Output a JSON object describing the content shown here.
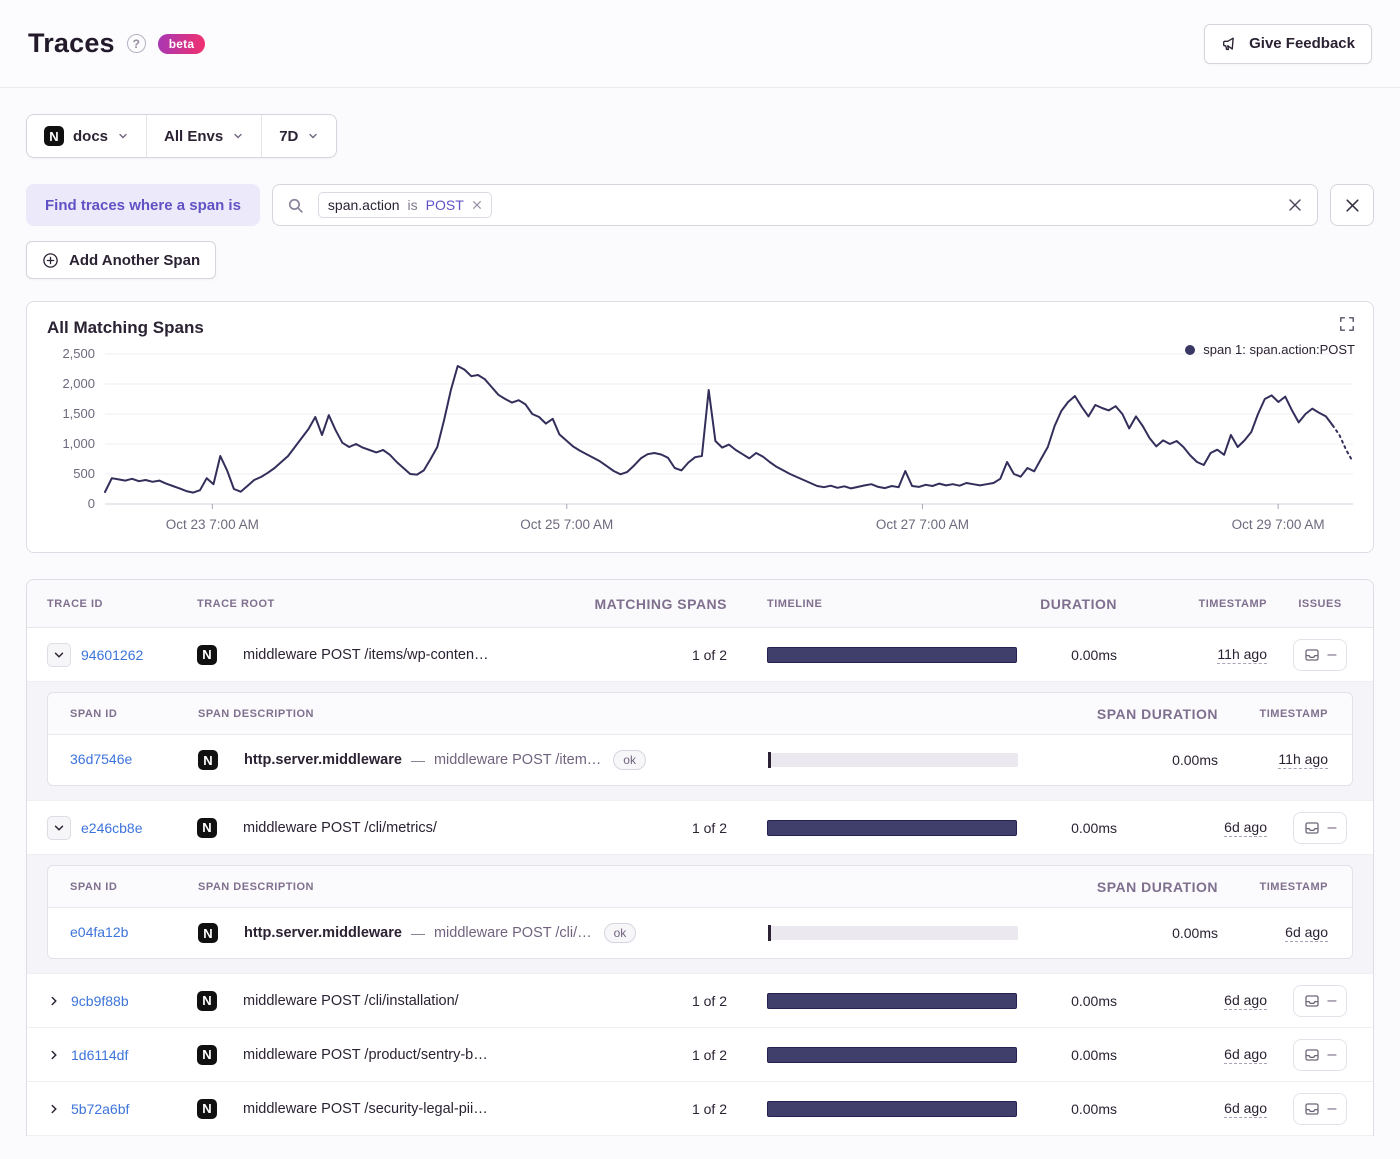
{
  "header": {
    "title": "Traces",
    "help_icon": "?",
    "beta_label": "beta",
    "feedback_label": "Give Feedback"
  },
  "filters": {
    "project": {
      "label": "docs",
      "platform_icon": "N"
    },
    "env": {
      "label": "All Envs"
    },
    "period": {
      "label": "7D"
    }
  },
  "search": {
    "prefix_label": "Find traces where a span is",
    "token": {
      "key": "span.action",
      "op": "is",
      "value": "POST"
    }
  },
  "actions": {
    "add_span_label": "Add Another Span"
  },
  "chart_data": {
    "type": "line",
    "title": "All Matching Spans",
    "legend": "span 1: span.action:POST",
    "series_name": "span 1: span.action:POST",
    "line_color": "#332f5b",
    "ylim": [
      0,
      2500
    ],
    "grid": true,
    "legend_position": "top-right",
    "y_ticks": [
      {
        "v": 0,
        "label": "0"
      },
      {
        "v": 500,
        "label": "500"
      },
      {
        "v": 1000,
        "label": "1,000"
      },
      {
        "v": 1500,
        "label": "1,500"
      },
      {
        "v": 2000,
        "label": "2,000"
      },
      {
        "v": 2500,
        "label": "2,500"
      }
    ],
    "x_ticks": [
      {
        "f": 0.086,
        "label": "Oct 23 7:00 AM"
      },
      {
        "f": 0.37,
        "label": "Oct 25 7:00 AM"
      },
      {
        "f": 0.655,
        "label": "Oct 27 7:00 AM"
      },
      {
        "f": 0.94,
        "label": "Oct 29 7:00 AM"
      }
    ],
    "tail_dotted_points": 3,
    "values": [
      200,
      430,
      410,
      390,
      420,
      380,
      400,
      370,
      390,
      340,
      300,
      260,
      215,
      190,
      230,
      430,
      330,
      800,
      560,
      250,
      205,
      300,
      400,
      450,
      520,
      600,
      700,
      800,
      950,
      1100,
      1250,
      1450,
      1150,
      1480,
      1230,
      1020,
      950,
      1000,
      940,
      900,
      860,
      900,
      820,
      700,
      600,
      500,
      490,
      560,
      750,
      950,
      1400,
      1900,
      2300,
      2240,
      2130,
      2150,
      2080,
      1950,
      1820,
      1750,
      1690,
      1730,
      1660,
      1500,
      1450,
      1340,
      1420,
      1160,
      1060,
      960,
      890,
      830,
      770,
      710,
      630,
      550,
      495,
      535,
      640,
      760,
      830,
      850,
      825,
      770,
      600,
      560,
      690,
      780,
      800,
      1900,
      1050,
      940,
      990,
      900,
      830,
      760,
      850,
      790,
      700,
      620,
      560,
      500,
      450,
      400,
      350,
      300,
      280,
      305,
      270,
      295,
      260,
      285,
      310,
      330,
      285,
      265,
      300,
      280,
      550,
      300,
      285,
      320,
      300,
      340,
      310,
      330,
      305,
      350,
      330,
      310,
      330,
      350,
      420,
      700,
      500,
      455,
      600,
      545,
      750,
      950,
      1300,
      1550,
      1700,
      1800,
      1620,
      1460,
      1650,
      1600,
      1560,
      1630,
      1500,
      1260,
      1460,
      1300,
      1100,
      960,
      1060,
      1000,
      1050,
      950,
      810,
      700,
      650,
      850,
      905,
      820,
      1150,
      950,
      1060,
      1200,
      1500,
      1750,
      1810,
      1700,
      1790,
      1560,
      1360,
      1500,
      1590,
      1520,
      1460,
      1310,
      1150,
      900,
      700
    ]
  },
  "table": {
    "columns": [
      "TRACE ID",
      "TRACE ROOT",
      "MATCHING SPANS",
      "TIMELINE",
      "DURATION",
      "TIMESTAMP",
      "ISSUES"
    ],
    "span_columns": [
      "SPAN ID",
      "SPAN DESCRIPTION",
      "SPAN DURATION",
      "TIMESTAMP"
    ],
    "platform_icon_label": "N",
    "op_separator": "—",
    "issues_placeholder": "–",
    "rows": [
      {
        "trace_id": "94601262",
        "root": "middleware POST /items/wp-conten…",
        "matching": "1 of 2",
        "duration": "0.00ms",
        "timestamp": "11h ago",
        "expanded": true,
        "spans": [
          {
            "span_id": "36d7546e",
            "op": "http.server.middleware",
            "desc": "middleware POST /item…",
            "status": "ok",
            "duration": "0.00ms",
            "timestamp": "11h ago"
          }
        ]
      },
      {
        "trace_id": "e246cb8e",
        "root": "middleware POST /cli/metrics/",
        "matching": "1 of 2",
        "duration": "0.00ms",
        "timestamp": "6d ago",
        "expanded": true,
        "spans": [
          {
            "span_id": "e04fa12b",
            "op": "http.server.middleware",
            "desc": "middleware POST /cli/…",
            "status": "ok",
            "duration": "0.00ms",
            "timestamp": "6d ago"
          }
        ]
      },
      {
        "trace_id": "9cb9f88b",
        "root": "middleware POST /cli/installation/",
        "matching": "1 of 2",
        "duration": "0.00ms",
        "timestamp": "6d ago",
        "expanded": false
      },
      {
        "trace_id": "1d6114df",
        "root": "middleware POST /product/sentry-b…",
        "matching": "1 of 2",
        "duration": "0.00ms",
        "timestamp": "6d ago",
        "expanded": false
      },
      {
        "trace_id": "5b72a6bf",
        "root": "middleware POST /security-legal-pii…",
        "matching": "1 of 2",
        "duration": "0.00ms",
        "timestamp": "6d ago",
        "expanded": false
      }
    ]
  }
}
